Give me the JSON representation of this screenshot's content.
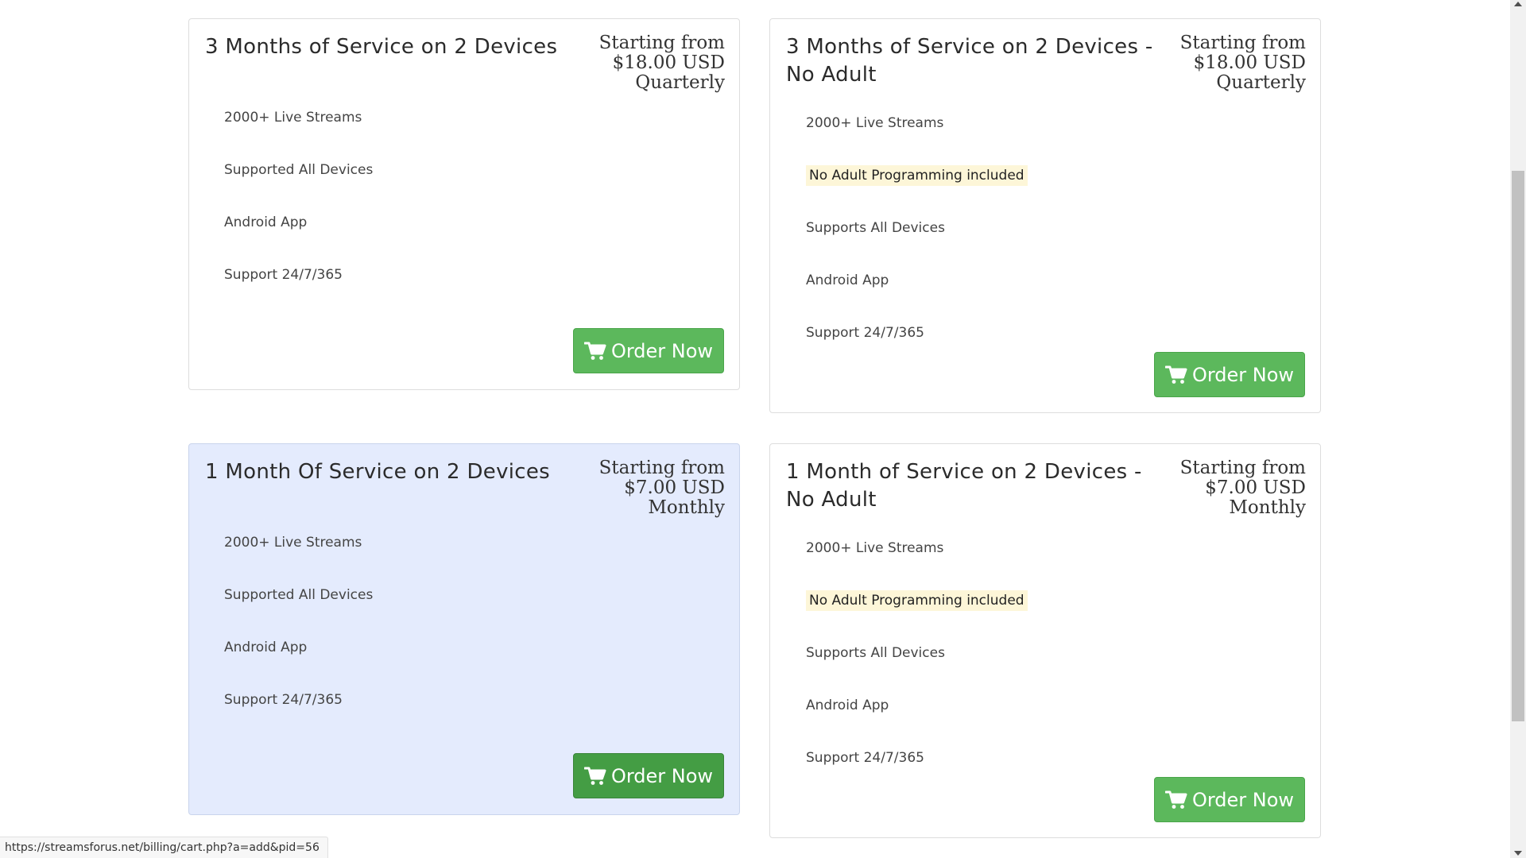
{
  "plans": [
    {
      "title": "3 Months of Service on 2 Devices",
      "price_lines": [
        "Starting from",
        "$18.00 USD",
        "Quarterly"
      ],
      "features": [
        {
          "text": "2000+ Live Streams"
        },
        {
          "text": "Supported All Devices"
        },
        {
          "text": "Android App"
        },
        {
          "text": "Support 24/7/365"
        }
      ],
      "button_label": "Order Now"
    },
    {
      "title": "3 Months of Service on 2 Devices - No Adult",
      "price_lines": [
        "Starting from",
        "$18.00 USD",
        "Quarterly"
      ],
      "features": [
        {
          "text": "2000+ Live Streams"
        },
        {
          "text": "No Adult Programming included"
        },
        {
          "text": "Supports All Devices"
        },
        {
          "text": "Android App"
        },
        {
          "text": "Support 24/7/365"
        }
      ],
      "button_label": "Order Now"
    },
    {
      "title": "1 Month Of Service on 2 Devices",
      "price_lines": [
        "Starting from",
        "$7.00 USD",
        "Monthly"
      ],
      "features": [
        {
          "text": "2000+ Live Streams"
        },
        {
          "text": "Supported All Devices"
        },
        {
          "text": "Android App"
        },
        {
          "text": "Support 24/7/365"
        }
      ],
      "button_label": "Order Now"
    },
    {
      "title": "1 Month of Service on 2 Devices - No Adult",
      "price_lines": [
        "Starting from",
        "$7.00 USD",
        "Monthly"
      ],
      "features": [
        {
          "text": "2000+ Live Streams"
        },
        {
          "text": "No Adult Programming included"
        },
        {
          "text": "Supports All Devices"
        },
        {
          "text": "Android App"
        },
        {
          "text": "Support 24/7/365"
        }
      ],
      "button_label": "Order Now"
    }
  ],
  "button_icon": "shopping-cart-icon",
  "status_bar": {
    "url": "https://streamsforus.net/billing/cart.php?a=add&pid=56"
  },
  "colors": {
    "button_green": "#5cb85c",
    "button_green_hover": "#449d44",
    "highlight_card_bg": "#e4ebfd",
    "no_adult_badge_bg": "#fdf6d8"
  }
}
